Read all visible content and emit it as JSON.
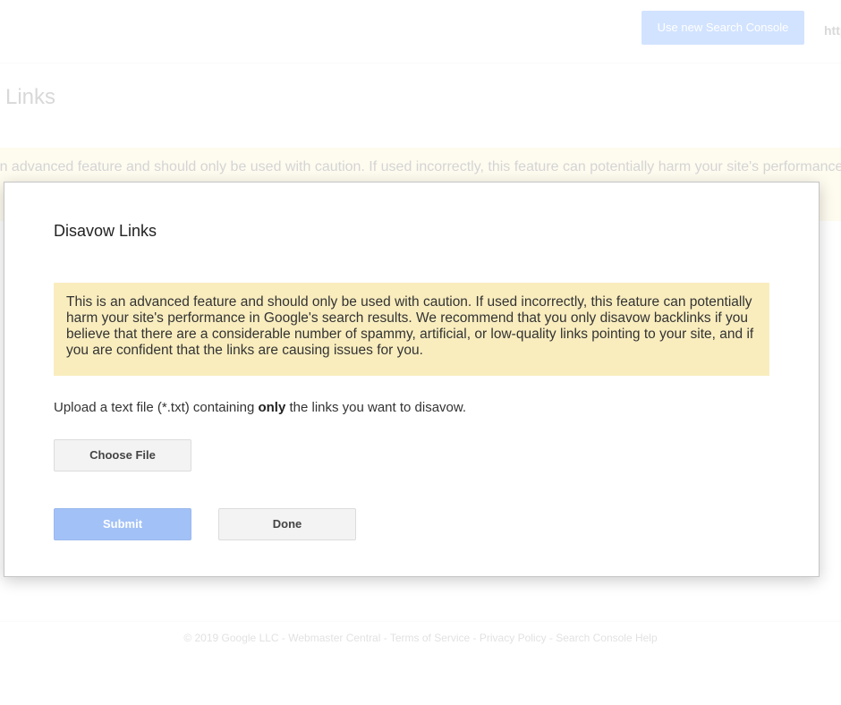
{
  "header": {
    "new_search_console_label": "Use new Search Console",
    "site_url": "https://"
  },
  "page": {
    "title": "Links",
    "background_warning": "This is an advanced feature and should only be used with caution. If used incorrectly, this feature can potentially harm your site's performance in Google's search results. We recommend that you only disavow backlinks if you believe that there are a considerable number of spammy, artificial, or low-quality links pointing to your site, and if you are confident that the links are causing issues for you."
  },
  "footer": {
    "copyright": "© 2019 Google LLC",
    "separator": " - ",
    "links": [
      "Webmaster Central",
      "Terms of Service",
      "Privacy Policy",
      "Search Console Help"
    ]
  },
  "dialog": {
    "title": "Disavow Links",
    "warning": "This is an advanced feature and should only be used with caution. If used incorrectly, this feature can potentially harm your site's performance in Google's search results. We recommend that you only disavow backlinks if you believe that there are a considerable number of spammy, artificial, or low-quality links pointing to your site, and if you are confident that the links are causing issues for you.",
    "upload_text_before": "Upload a text file (*.txt) containing ",
    "upload_text_bold": "only",
    "upload_text_after": " the links you want to disavow.",
    "choose_file_label": "Choose File",
    "submit_label": "Submit",
    "done_label": "Done"
  },
  "colors": {
    "primary_blue": "#4d90fe",
    "submit_disabled": "#a2c1f7",
    "warning_bg": "#f9edbe"
  }
}
